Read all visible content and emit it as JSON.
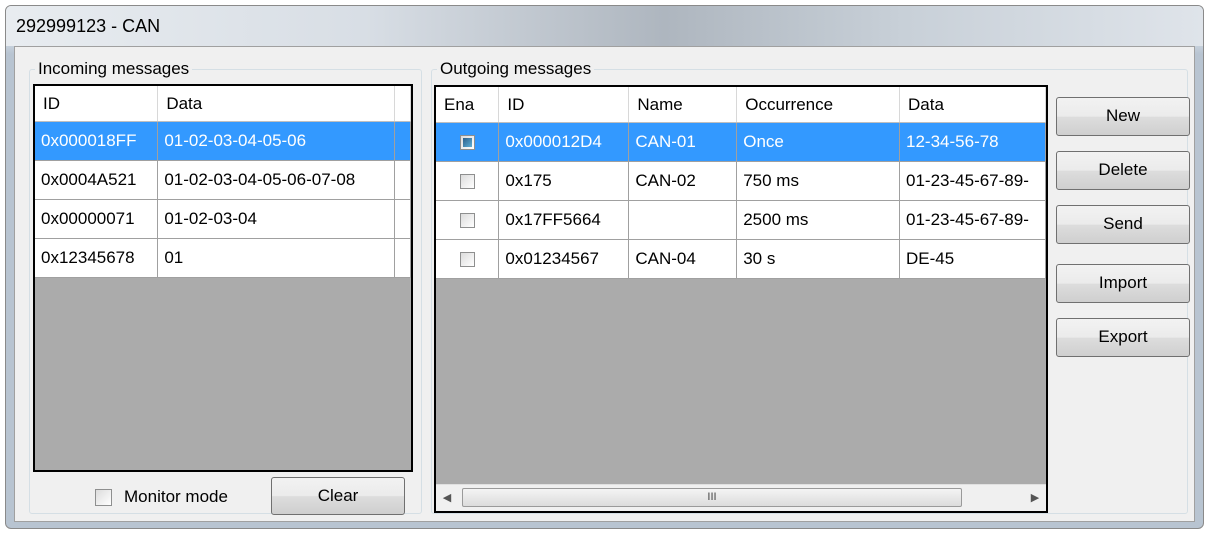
{
  "window": {
    "title": "292999123 - CAN"
  },
  "incoming": {
    "legend": "Incoming messages",
    "columns": [
      "ID",
      "Data"
    ],
    "rows": [
      {
        "id": "0x000018FF",
        "data": "01-02-03-04-05-06",
        "selected": true
      },
      {
        "id": "0x0004A521",
        "data": "01-02-03-04-05-06-07-08",
        "selected": false
      },
      {
        "id": "0x00000071",
        "data": "01-02-03-04",
        "selected": false
      },
      {
        "id": "0x12345678",
        "data": "01",
        "selected": false
      }
    ],
    "monitor_mode_label": "Monitor mode",
    "monitor_mode_checked": false,
    "clear_label": "Clear"
  },
  "outgoing": {
    "legend": "Outgoing messages",
    "columns": [
      "Ena",
      "ID",
      "Name",
      "Occurrence",
      "Data"
    ],
    "rows": [
      {
        "ena": true,
        "id": "0x000012D4",
        "name": "CAN-01",
        "occurrence": "Once",
        "data": "12-34-56-78",
        "selected": true
      },
      {
        "ena": false,
        "id": "0x175",
        "name": "CAN-02",
        "occurrence": "750 ms",
        "data": "01-23-45-67-89-",
        "selected": false
      },
      {
        "ena": false,
        "id": "0x17FF5664",
        "name": "",
        "occurrence": "2500 ms",
        "data": "01-23-45-67-89-",
        "selected": false
      },
      {
        "ena": false,
        "id": "0x01234567",
        "name": "CAN-04",
        "occurrence": "30 s",
        "data": "DE-45",
        "selected": false
      }
    ],
    "scroll_thumb_glyph": "III"
  },
  "buttons": {
    "new": "New",
    "delete": "Delete",
    "send": "Send",
    "import": "Import",
    "export": "Export"
  },
  "colors": {
    "selection": "#3399ff",
    "grid_empty": "#ababab"
  }
}
